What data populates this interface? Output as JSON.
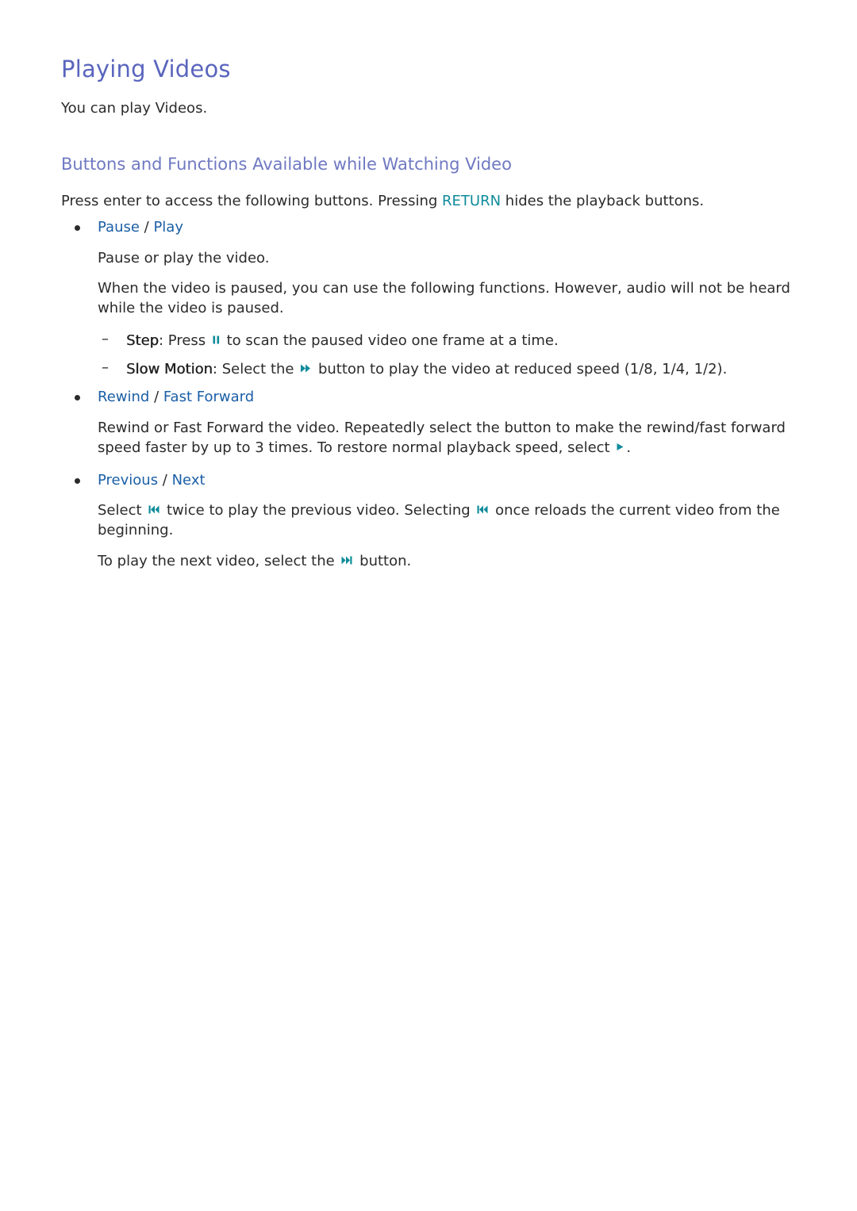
{
  "page": {
    "title": "Playing Videos",
    "intro": "You can play Videos.",
    "section_title": "Buttons and Functions Available while Watching Video",
    "section_intro": {
      "before": "Press enter to access the following buttons. Pressing ",
      "keyword": "RETURN",
      "after": " hides the playback buttons."
    },
    "items": [
      {
        "label_a": "Pause",
        "separator": " / ",
        "label_b": "Play",
        "desc1": "Pause or play the video.",
        "desc2": "When the video is paused, you can use the following functions. However, audio will not be heard while the video is paused.",
        "subitems": [
          {
            "term": "Step",
            "colon": ":",
            "before_icon": " Press ",
            "icon": "pause-icon",
            "after_icon": " to scan the paused video one frame at a time."
          },
          {
            "term": "Slow Motion",
            "colon": ":",
            "before_icon": " Select the ",
            "icon": "fast-forward-icon",
            "after_icon": " button to play the video at reduced speed (1/8, 1/4, 1/2)."
          }
        ]
      },
      {
        "label_a": "Rewind",
        "separator": " / ",
        "label_b": "Fast Forward",
        "desc_line1": "Rewind or Fast Forward the video. Repeatedly select the button to make the rewind/fast forward",
        "desc_line2_before": "speed faster by up to 3 times. To restore normal playback speed, select ",
        "desc_icon": "play-icon",
        "desc_line2_after": "."
      },
      {
        "label_a": "Previous",
        "separator": " / ",
        "label_b": "Next",
        "desc1_before": "Select ",
        "desc1_icon": "skip-previous-icon",
        "desc1_mid": " twice to play the previous video. Selecting ",
        "desc1_icon2": "skip-previous-icon",
        "desc1_after": " once reloads the current video from the",
        "desc1_line2": "beginning.",
        "desc2_before": "To play the next video, select the ",
        "desc2_icon": "skip-next-icon",
        "desc2_after": " button."
      }
    ]
  },
  "colors": {
    "title": "#5a65bd",
    "subtitle": "#6f79c2",
    "keyword": "#0f8b9b",
    "link": "#1b5fa6",
    "body_text": "#2b2b2b"
  }
}
